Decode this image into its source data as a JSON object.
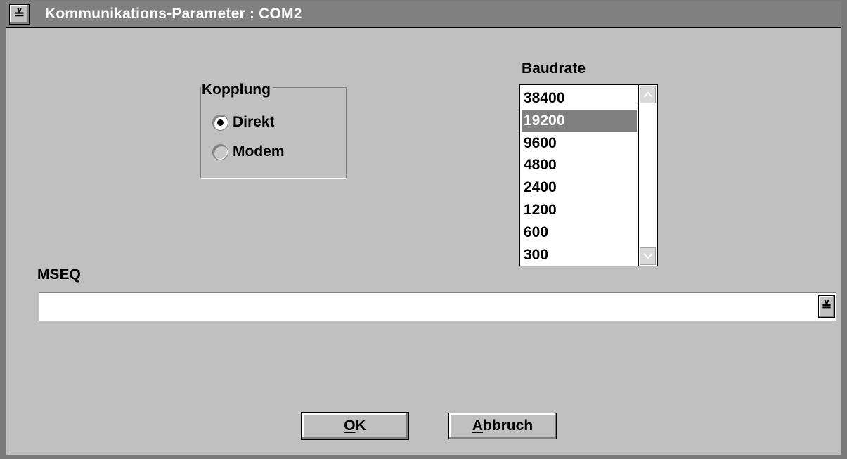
{
  "window": {
    "title": "Kommunikations-Parameter : COM2",
    "system_menu_icon": "≚"
  },
  "coupling": {
    "label": "Kopplung",
    "options": [
      {
        "label": "Direkt",
        "selected": true
      },
      {
        "label": "Modem",
        "selected": false
      }
    ]
  },
  "baudrate": {
    "label": "Baudrate",
    "items": [
      "38400",
      "19200",
      "9600",
      "4800",
      "2400",
      "1200",
      "600",
      "300"
    ],
    "selected": "19200",
    "scroll_up_icon": "^",
    "scroll_down_icon": "v"
  },
  "mseq": {
    "label": "MSEQ",
    "value": "",
    "dropdown_icon": "≚"
  },
  "buttons": {
    "ok_mnemonic": "O",
    "ok_rest": "K",
    "cancel_mnemonic": "A",
    "cancel_rest": "bbruch"
  },
  "colors": {
    "face": "#c0c0c0",
    "title": "#808080",
    "selection": "#808080"
  }
}
